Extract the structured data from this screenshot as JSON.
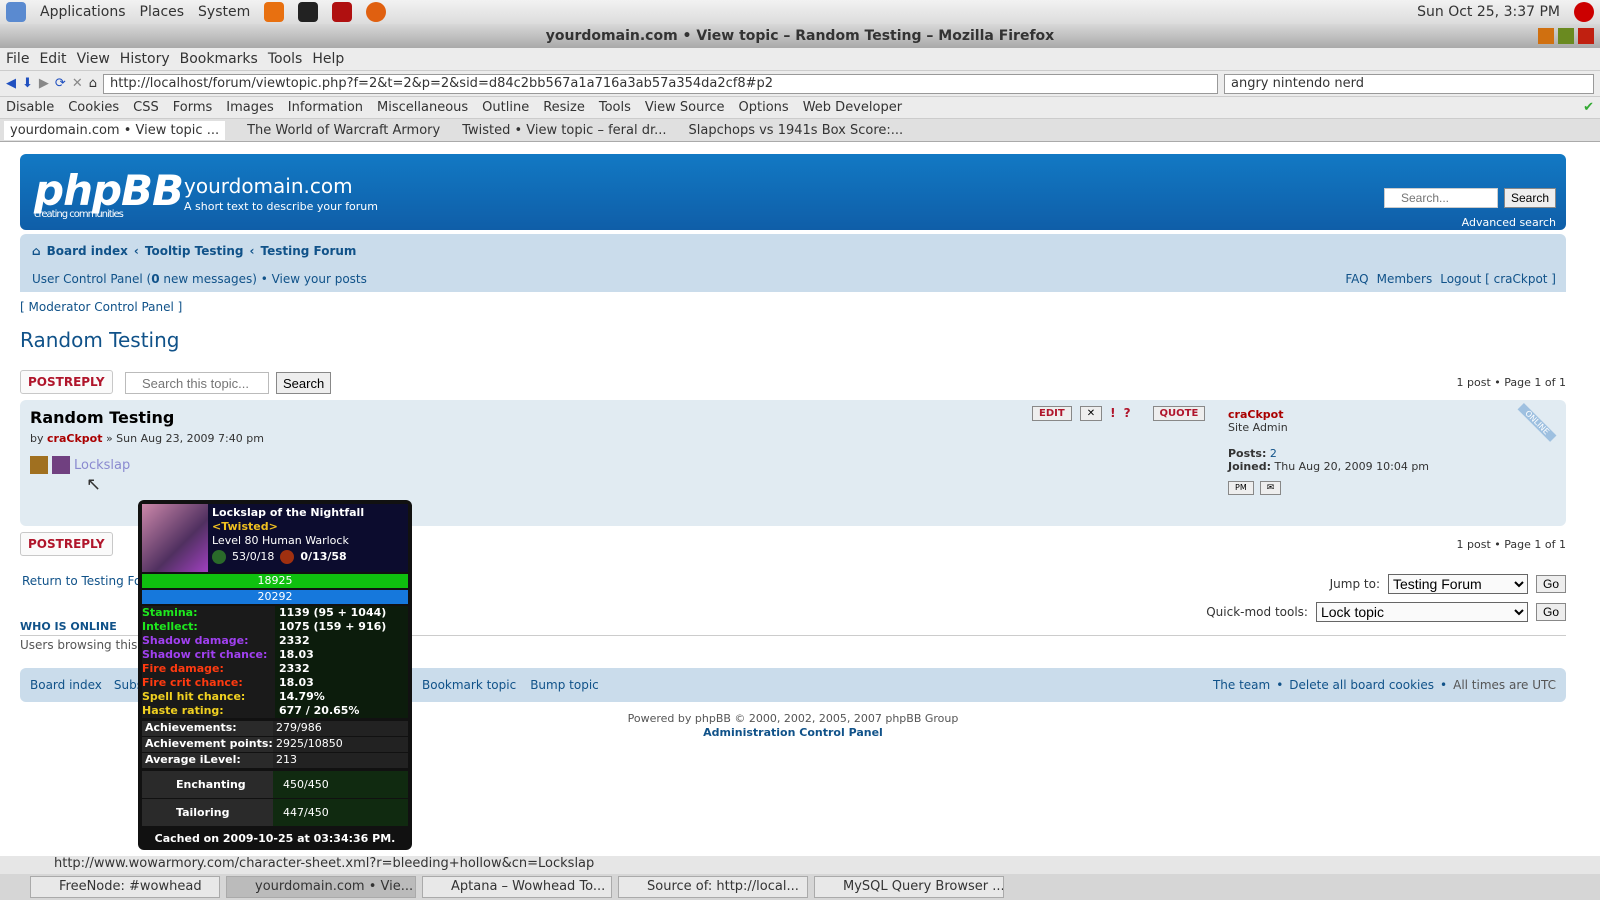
{
  "panel": {
    "menus": [
      "Applications",
      "Places",
      "System"
    ],
    "clock": "Sun Oct 25,  3:37 PM"
  },
  "window": {
    "title": "yourdomain.com • View topic – Random Testing – Mozilla Firefox"
  },
  "menu": [
    "File",
    "Edit",
    "View",
    "History",
    "Bookmarks",
    "Tools",
    "Help"
  ],
  "nav": {
    "url": "http://localhost/forum/viewtopic.php?f=2&t=2&p=2&sid=d84c2bb567a1a716a3ab57a354da2cf8#p2",
    "search": "angry nintendo nerd"
  },
  "devbar": [
    "Disable",
    "Cookies",
    "CSS",
    "Forms",
    "Images",
    "Information",
    "Miscellaneous",
    "Outline",
    "Resize",
    "Tools",
    "View Source",
    "Options",
    "Web Developer"
  ],
  "tabs": [
    "yourdomain.com • View topic ...",
    "The World of Warcraft Armory",
    "Twisted • View topic – feral dr...",
    "Slapchops vs 1941s Box Score:..."
  ],
  "header": {
    "site": "yourdomain.com",
    "desc": "A short text to describe your forum",
    "logo": "phpBB",
    "logo_sub": "creating  communities",
    "search_placeholder": "Search...",
    "search_btn": "Search",
    "advanced": "Advanced search"
  },
  "breadcrumb": [
    "Board index",
    "Tooltip Testing",
    "Testing Forum"
  ],
  "userbar": {
    "ucp": "User Control Panel (",
    "new": "0",
    "new_rest": " new messages)",
    "sep": " • ",
    "posts": "View your posts",
    "faq": "FAQ",
    "members": "Members",
    "logout": "Logout [ craCkpot ]"
  },
  "mcp": "[ Moderator Control Panel ]",
  "topic": {
    "title": "Random Testing",
    "postreply": "POSTREPLY",
    "search_placeholder": "Search this topic...",
    "search_btn": "Search",
    "pagination": "1 post • Page 1 of 1"
  },
  "post": {
    "title": "Random Testing",
    "by": "by",
    "author": "craCkpot",
    "date": " » Sun Aug 23, 2009 7:40 pm",
    "link": "Lockslap",
    "edit": "EDIT",
    "quote": "QUOTE",
    "rank": "Site Admin",
    "posts_label": "Posts:",
    "posts": "2",
    "joined_label": "Joined:",
    "joined": "Thu Aug 20, 2009 10:04 pm",
    "online": "ONLINE",
    "pm": "PM"
  },
  "tooltip": {
    "name": "Lockslap of the Nightfall",
    "guild": "<Twisted>",
    "class": "Level 80 Human Warlock",
    "spec1": "53/0/18",
    "spec2": "0/13/58",
    "health": "18925",
    "mana": "20292",
    "stats": [
      {
        "k": "Stamina:",
        "v": "1139 (95 + 1044)",
        "c": "#1ee81e"
      },
      {
        "k": "Intellect:",
        "v": "1075 (159 + 916)",
        "c": "#1ee81e"
      },
      {
        "k": "Shadow damage:",
        "v": "2332",
        "c": "#a040f0"
      },
      {
        "k": "Shadow crit chance:",
        "v": "18.03",
        "c": "#a040f0"
      },
      {
        "k": "Fire damage:",
        "v": "2332",
        "c": "#ff3a10"
      },
      {
        "k": "Fire crit chance:",
        "v": "18.03",
        "c": "#ff3a10"
      },
      {
        "k": "Spell hit chance:",
        "v": "14.79%",
        "c": "#f0d020"
      },
      {
        "k": "Haste rating:",
        "v": "677 / 20.65%",
        "c": "#f0d020"
      }
    ],
    "ach": [
      {
        "k": "Achievements:",
        "v": "279/986"
      },
      {
        "k": "Achievement points:",
        "v": "2925/10850"
      },
      {
        "k": "Average iLevel:",
        "v": "213"
      }
    ],
    "prof": [
      {
        "k": "Enchanting",
        "v": "450/450"
      },
      {
        "k": "Tailoring",
        "v": "447/450"
      }
    ],
    "cached": "Cached on 2009-10-25 at 03:34:36 PM."
  },
  "bottom": {
    "return": "Return to Testing Forum",
    "jump_label": "Jump to:",
    "jump": "Testing Forum",
    "go": "Go",
    "qm_label": "Quick-mod tools:",
    "qm": "Lock topic"
  },
  "online": {
    "title": "WHO IS ONLINE",
    "text": "Users browsing this forum: craCkpot and 0 guests"
  },
  "footer": {
    "board": "Board index",
    "subscribe": "Subscribe topic",
    "bookmark": "Bookmark topic",
    "bump": "Bump topic",
    "team": "The team",
    "cookies": "Delete all board cookies",
    "times": "All times are UTC",
    "powered": "Powered by phpBB © 2000, 2002, 2005, 2007 phpBB Group",
    "acp": "Administration Control Panel"
  },
  "status": "http://www.wowarmory.com/character-sheet.xml?r=bleeding+hollow&cn=Lockslap",
  "taskbar": [
    "FreeNode: #wowhead",
    "yourdomain.com • Vie...",
    "Aptana – Wowhead To...",
    "Source of: http://local...",
    "MySQL Query Browser ..."
  ]
}
